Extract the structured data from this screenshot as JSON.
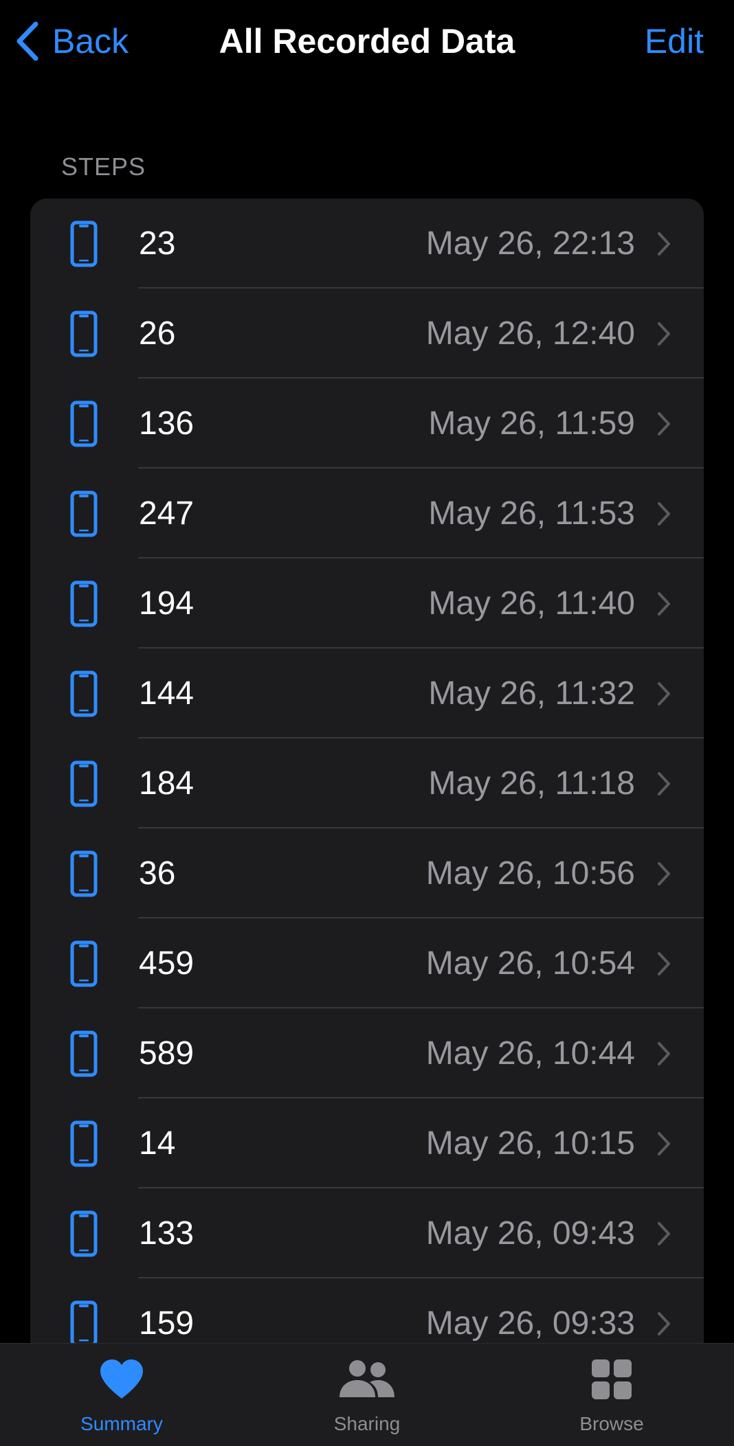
{
  "nav": {
    "back_label": "Back",
    "title": "All Recorded Data",
    "edit_label": "Edit"
  },
  "section": {
    "header": "STEPS"
  },
  "rows": [
    {
      "value": "23",
      "date": "May 26, 22:13",
      "icon": "iphone-icon"
    },
    {
      "value": "26",
      "date": "May 26, 12:40",
      "icon": "iphone-icon"
    },
    {
      "value": "136",
      "date": "May 26, 11:59",
      "icon": "iphone-icon"
    },
    {
      "value": "247",
      "date": "May 26, 11:53",
      "icon": "iphone-icon"
    },
    {
      "value": "194",
      "date": "May 26, 11:40",
      "icon": "iphone-icon"
    },
    {
      "value": "144",
      "date": "May 26, 11:32",
      "icon": "iphone-icon"
    },
    {
      "value": "184",
      "date": "May 26, 11:18",
      "icon": "iphone-icon"
    },
    {
      "value": "36",
      "date": "May 26, 10:56",
      "icon": "iphone-icon"
    },
    {
      "value": "459",
      "date": "May 26, 10:54",
      "icon": "iphone-icon"
    },
    {
      "value": "589",
      "date": "May 26, 10:44",
      "icon": "iphone-icon"
    },
    {
      "value": "14",
      "date": "May 26, 10:15",
      "icon": "iphone-icon"
    },
    {
      "value": "133",
      "date": "May 26, 09:43",
      "icon": "iphone-icon"
    },
    {
      "value": "159",
      "date": "May 26, 09:33",
      "icon": "iphone-icon"
    }
  ],
  "tabbar": {
    "summary_label": "Summary",
    "sharing_label": "Sharing",
    "browse_label": "Browse",
    "active": "Summary"
  },
  "colors": {
    "accent": "#2f8cff",
    "background": "#000000",
    "cell": "#1c1c1e",
    "secondary_text": "#98989f"
  }
}
